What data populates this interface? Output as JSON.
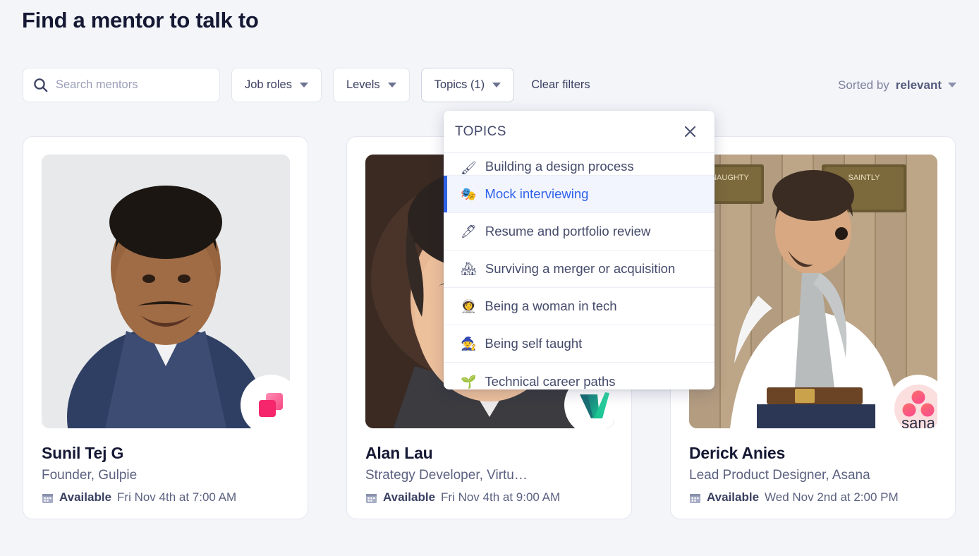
{
  "page": {
    "title": "Find a mentor to talk to",
    "background_color": "#f4f5f9"
  },
  "search": {
    "placeholder": "Search mentors",
    "value": "",
    "icon": "search-icon"
  },
  "filters": [
    {
      "label": "Job roles",
      "open": false
    },
    {
      "label": "Levels",
      "open": false
    },
    {
      "label": "Topics (1)",
      "open": true
    }
  ],
  "clear_filters_label": "Clear filters",
  "sort": {
    "prefix": "Sorted by",
    "value": "relevant"
  },
  "topics_dropdown": {
    "header": "TOPICS",
    "close_icon": "close-icon",
    "items": [
      {
        "emoji": "🖌",
        "label": "Building a design process",
        "selected": false,
        "partial": true
      },
      {
        "emoji": "🎭",
        "label": "Mock interviewing",
        "selected": true,
        "partial": false
      },
      {
        "emoji": "🖊",
        "label": "Resume and portfolio review",
        "selected": false,
        "partial": false
      },
      {
        "emoji": "🏘",
        "label": "Surviving a merger or acquisition",
        "selected": false,
        "partial": false
      },
      {
        "emoji": "👩‍🚀",
        "label": "Being a woman in tech",
        "selected": false,
        "partial": false
      },
      {
        "emoji": "🧙",
        "label": "Being self taught",
        "selected": false,
        "partial": false
      },
      {
        "emoji": "🌱",
        "label": "Technical career paths",
        "selected": false,
        "partial": false
      }
    ],
    "selected_color": "#2f62e8",
    "selected_bg": "#f2f5fe"
  },
  "mentors": [
    {
      "name": "Sunil Tej G",
      "role": "Founder, Gulpie",
      "availability_label": "Available",
      "availability_time": "Fri Nov 4th at 7:00 AM",
      "company_badge": "gulpie-logo",
      "badge_color": "#f5266c"
    },
    {
      "name": "Alan Lau",
      "role": "Strategy Developer, Virtu…",
      "availability_label": "Available",
      "availability_time": "Fri Nov 4th at 9:00 AM",
      "company_badge": "virtu-logo",
      "badge_color": "#16b48a"
    },
    {
      "name": "Derick Anies",
      "role": "Lead Product Designer, Asana",
      "availability_label": "Available",
      "availability_time": "Wed Nov 2nd at 2:00 PM",
      "company_badge": "asana-logo",
      "badge_color": "#f96d5b"
    }
  ]
}
